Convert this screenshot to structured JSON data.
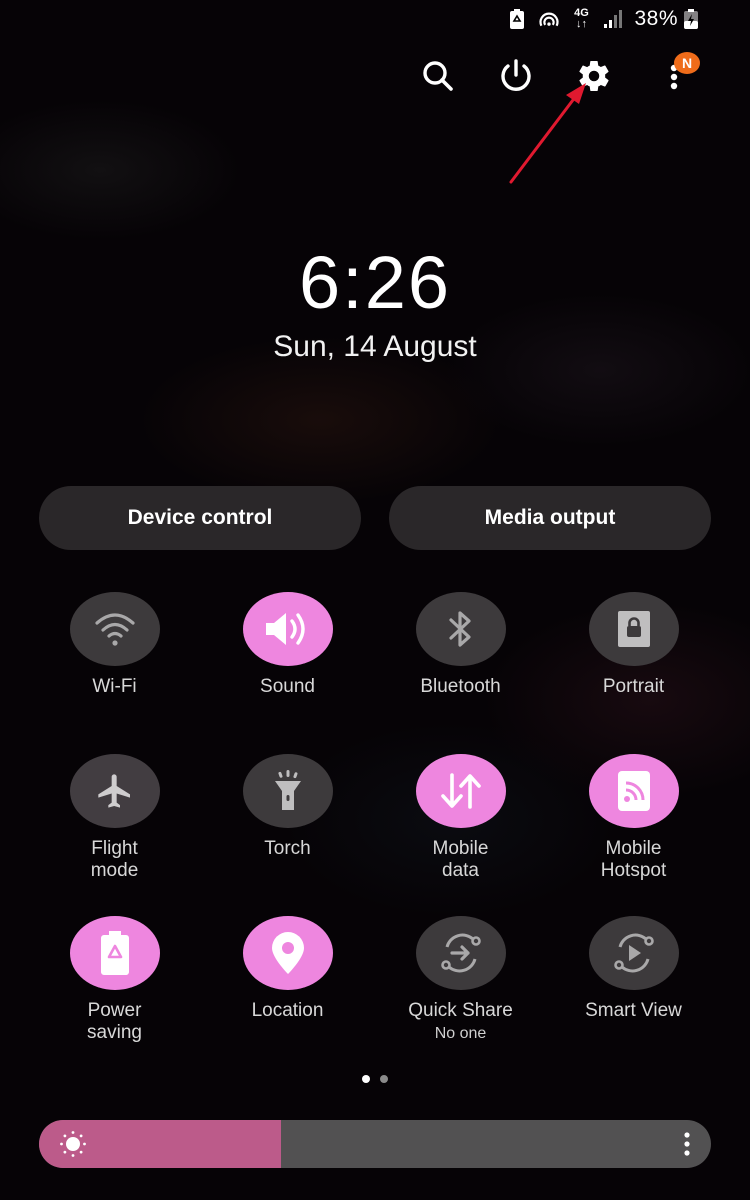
{
  "status_bar": {
    "battery_percent": "38%",
    "network_type": "4G",
    "icons": [
      "power-saving-icon",
      "hotspot-icon",
      "mobile-data-4g-icon",
      "signal-icon",
      "battery-charging-icon"
    ]
  },
  "top_actions": {
    "icons": [
      "search-icon",
      "power-icon",
      "settings-icon",
      "more-options-icon"
    ],
    "notification_badge": "N"
  },
  "clock": {
    "time": "6:26",
    "date": "Sun, 14 August"
  },
  "controls": {
    "device_control": "Device control",
    "media_output": "Media output"
  },
  "tiles": [
    {
      "label": "Wi-Fi",
      "state": "off",
      "icon": "wifi-icon"
    },
    {
      "label": "Sound",
      "state": "on",
      "icon": "sound-icon"
    },
    {
      "label": "Bluetooth",
      "state": "off",
      "icon": "bluetooth-icon"
    },
    {
      "label": "Portrait",
      "state": "off",
      "icon": "portrait-lock-icon"
    },
    {
      "label": "Flight mode",
      "state": "off",
      "icon": "airplane-icon"
    },
    {
      "label": "Torch",
      "state": "off",
      "icon": "torch-icon"
    },
    {
      "label": "Mobile data",
      "state": "on",
      "icon": "mobile-data-icon"
    },
    {
      "label": "Mobile Hotspot",
      "state": "on",
      "icon": "hotspot-icon"
    },
    {
      "label": "Power saving",
      "state": "on",
      "icon": "power-saving-icon"
    },
    {
      "label": "Location",
      "state": "on",
      "icon": "location-icon"
    },
    {
      "label": "Quick Share",
      "sub": "No one",
      "state": "off",
      "icon": "quick-share-icon"
    },
    {
      "label": "Smart View",
      "state": "off",
      "icon": "smart-view-icon"
    }
  ],
  "pagination": {
    "current": 1,
    "total": 2
  },
  "brightness": {
    "level_percent": 36
  },
  "colors": {
    "tile_on": "#ee86df",
    "tile_off": "#3d3a3c",
    "brightness_fill": "#bc5b8a",
    "badge": "#ef6c1a",
    "annotation_arrow": "#e0192f"
  }
}
